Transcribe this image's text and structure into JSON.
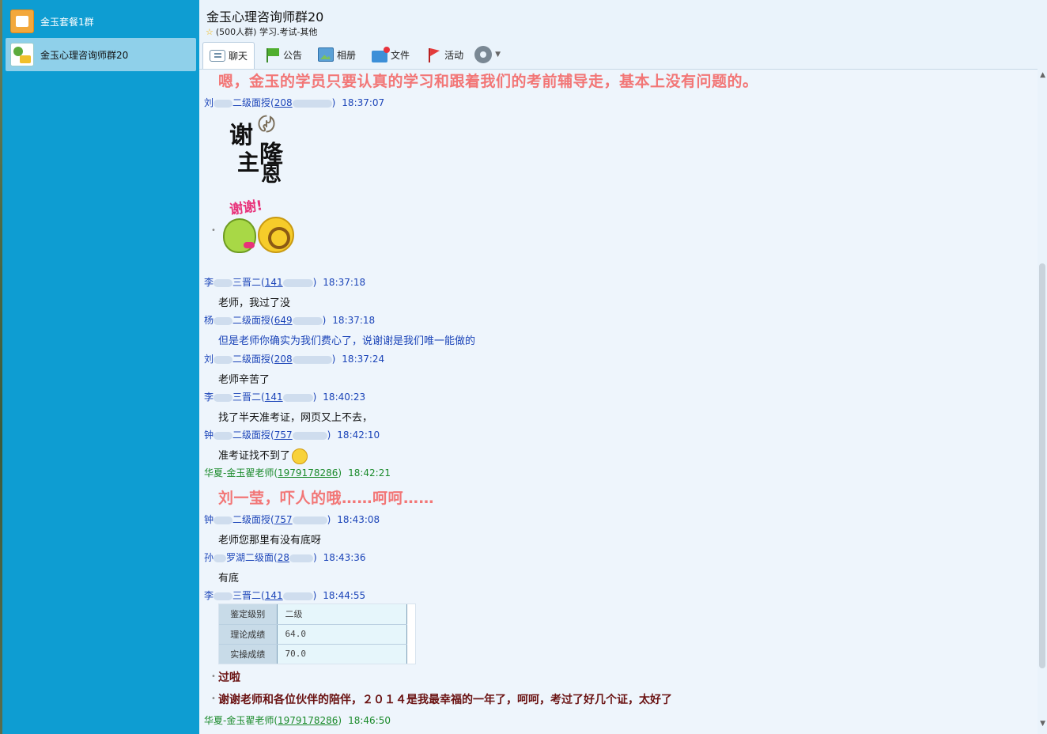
{
  "sidebar": {
    "sessions": [
      {
        "label": "金玉套餐1群"
      },
      {
        "label": "金玉心理咨询师群20"
      }
    ]
  },
  "header": {
    "title": "金玉心理咨询师群20",
    "subtitle": "(500人群) 学习.考试-其他"
  },
  "tabs": [
    {
      "label": "聊天",
      "icon": "chat-icon"
    },
    {
      "label": "公告",
      "icon": "flag-icon"
    },
    {
      "label": "相册",
      "icon": "photo-icon"
    },
    {
      "label": "文件",
      "icon": "folder-icon"
    },
    {
      "label": "活动",
      "icon": "activity-flag-icon"
    }
  ],
  "chat": {
    "top_message": "嗯，金玉的学员只要认真的学习和跟着我们的考前辅导走，基本上没有问题的。",
    "messages": [
      {
        "name_a": "刘",
        "name_b": "二级面授(",
        "id": "208",
        "time": "18:37:07"
      },
      {
        "sticker_text": "谢谢!"
      },
      {
        "name_a": "李",
        "name_b": "三晋二(",
        "id": "141",
        "time": "18:37:18",
        "text": "老师，我过了没"
      },
      {
        "name_a": "杨",
        "name_b": "二级面授(",
        "id": "649",
        "time": "18:37:18",
        "text": "但是老师你确实为我们费心了，说谢谢是我们唯一能做的"
      },
      {
        "name_a": "刘",
        "name_b": "二级面授(",
        "id": "208",
        "time": "18:37:24",
        "text": "老师辛苦了"
      },
      {
        "name_a": "李",
        "name_b": "三晋二(",
        "id": "141",
        "time": "18:40:23",
        "text": "找了半天准考证，网页又上不去，"
      },
      {
        "name_a": "钟",
        "name_b": "二级面授(",
        "id": "757",
        "time": "18:42:10",
        "text": "准考证找不到了"
      },
      {
        "name": "华夏-金玉翟老师(",
        "id": "1979178286",
        "time": "18:42:21",
        "text": "刘一莹，吓人的哦……呵呵……"
      },
      {
        "name_a": "钟",
        "name_b": "二级面授(",
        "id": "757",
        "time": "18:43:08",
        "text": "老师您那里有没有底呀"
      },
      {
        "name_a": "孙",
        "name_b": "罗湖二级面(",
        "id": "28",
        "time": "18:43:36",
        "text": "有底"
      },
      {
        "name_a": "李",
        "name_b": "三晋二(",
        "id": "141",
        "time": "18:44:55"
      },
      {
        "text1": "过啦",
        "text2": "谢谢老师和各位伙伴的陪伴，２０１４是我最幸福的一年了，呵呵，考过了好几个证，太好了"
      },
      {
        "name": "华夏-金玉翟老师(",
        "id": "1979178286",
        "time": "18:46:50"
      }
    ],
    "score_table": [
      {
        "key": "鉴定级别",
        "value": "二级"
      },
      {
        "key": "理论成绩",
        "value": "64.0"
      },
      {
        "key": "实操成绩",
        "value": "70.0"
      }
    ]
  }
}
